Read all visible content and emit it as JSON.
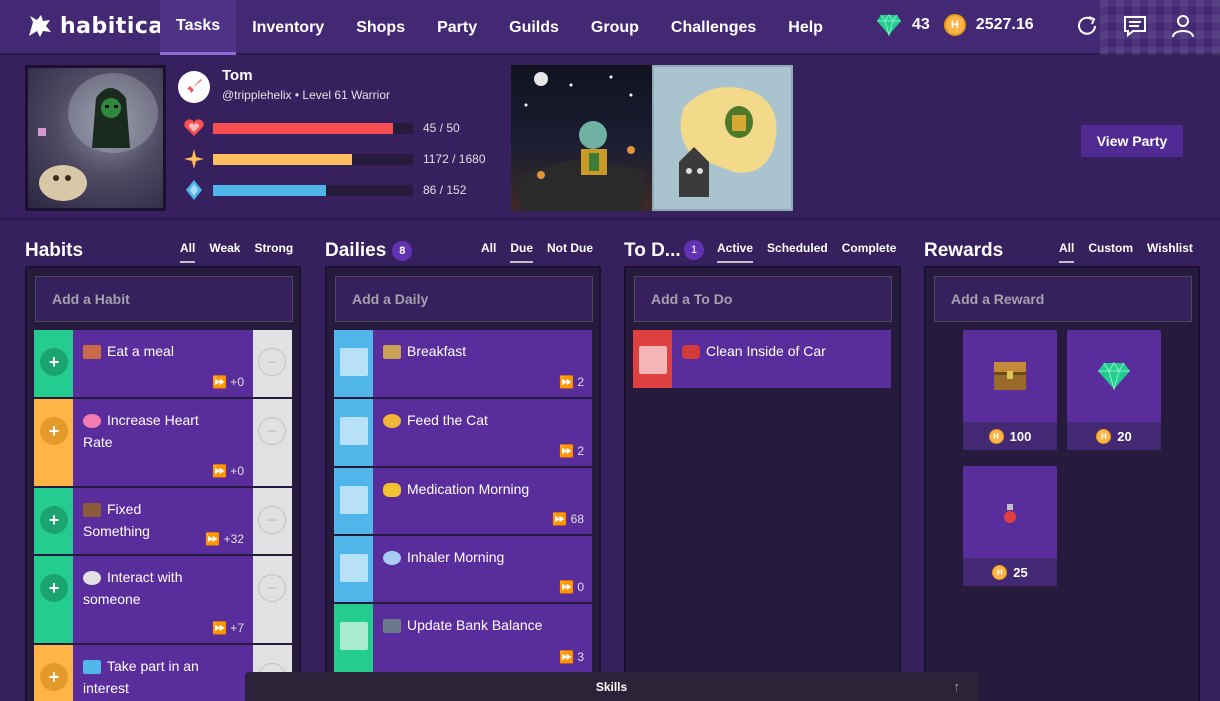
{
  "app": {
    "name": "habitica"
  },
  "nav": {
    "items": [
      "Tasks",
      "Inventory",
      "Shops",
      "Party",
      "Guilds",
      "Group",
      "Challenges",
      "Help"
    ],
    "active": "Tasks"
  },
  "currency": {
    "gems": "43",
    "gold": "2527.16"
  },
  "user": {
    "name": "Tom",
    "info": "@tripplehelix • Level 61 Warrior"
  },
  "stats": [
    {
      "icon": "heart-icon",
      "value": "45 / 50",
      "fraction": 0.9,
      "color": "#f74e52"
    },
    {
      "icon": "experience-star-icon",
      "value": "1172 / 1680",
      "fraction": 0.697,
      "color": "#ffbe5d"
    },
    {
      "icon": "mana-gem-icon",
      "value": "86 / 152",
      "fraction": 0.566,
      "color": "#50b5e9"
    }
  ],
  "party": {
    "button": "View Party"
  },
  "habits": {
    "title": "Habits",
    "filters": [
      "All",
      "Weak",
      "Strong"
    ],
    "active_filter": "All",
    "placeholder": "Add a Habit",
    "tasks": [
      {
        "text": "Eat a meal",
        "meta": "⏩ +0",
        "color": "#24cc8f",
        "icon": "meal-icon"
      },
      {
        "text": "Increase Heart Rate",
        "meta": "⏩ +0",
        "color": "#ffb445",
        "icon": "heart-icon"
      },
      {
        "text": "Fixed Something",
        "meta": "⏩ +32",
        "color": "#24cc8f",
        "icon": "hammer-icon"
      },
      {
        "text": "Interact with someone",
        "meta": "⏩ +7",
        "color": "#24cc8f",
        "icon": "speech-bubble-icon"
      },
      {
        "text": "Take part in an interest",
        "meta": "",
        "color": "#ffb445",
        "icon": "computer-icon"
      }
    ]
  },
  "dailies": {
    "title": "Dailies",
    "count": "8",
    "filters": [
      "All",
      "Due",
      "Not Due"
    ],
    "active_filter": "Due",
    "placeholder": "Add a Daily",
    "tasks": [
      {
        "text": "Breakfast",
        "meta": "⏩ 2",
        "color": "#50b5e9",
        "icon": "shield-icon"
      },
      {
        "text": "Feed the Cat",
        "meta": "⏩ 2",
        "color": "#50b5e9",
        "icon": "cat-icon"
      },
      {
        "text": "Medication Morning",
        "meta": "⏩ 68",
        "color": "#50b5e9",
        "icon": "pill-icon"
      },
      {
        "text": "Inhaler Morning",
        "meta": "⏩ 0",
        "color": "#50b5e9",
        "icon": "wind-icon"
      },
      {
        "text": "Update Bank Balance",
        "meta": "⏩ 3",
        "color": "#24cc8f",
        "icon": "atm-icon"
      }
    ]
  },
  "todos": {
    "title": "To D...",
    "count": "1",
    "filters": [
      "Active",
      "Scheduled",
      "Complete"
    ],
    "active_filter": "Active",
    "placeholder": "Add a To Do",
    "tasks": [
      {
        "text": "Clean Inside of Car",
        "color": "#de3f3f",
        "icon": "car-icon"
      }
    ]
  },
  "rewards": {
    "title": "Rewards",
    "filters": [
      "All",
      "Custom",
      "Wishlist"
    ],
    "active_filter": "All",
    "placeholder": "Add a Reward",
    "items": [
      {
        "price": "100",
        "icon": "treasure-chest-icon"
      },
      {
        "price": "20",
        "icon": "gem-icon"
      },
      {
        "price": "25",
        "icon": "health-potion-icon"
      }
    ]
  },
  "skills": {
    "label": "Skills"
  }
}
